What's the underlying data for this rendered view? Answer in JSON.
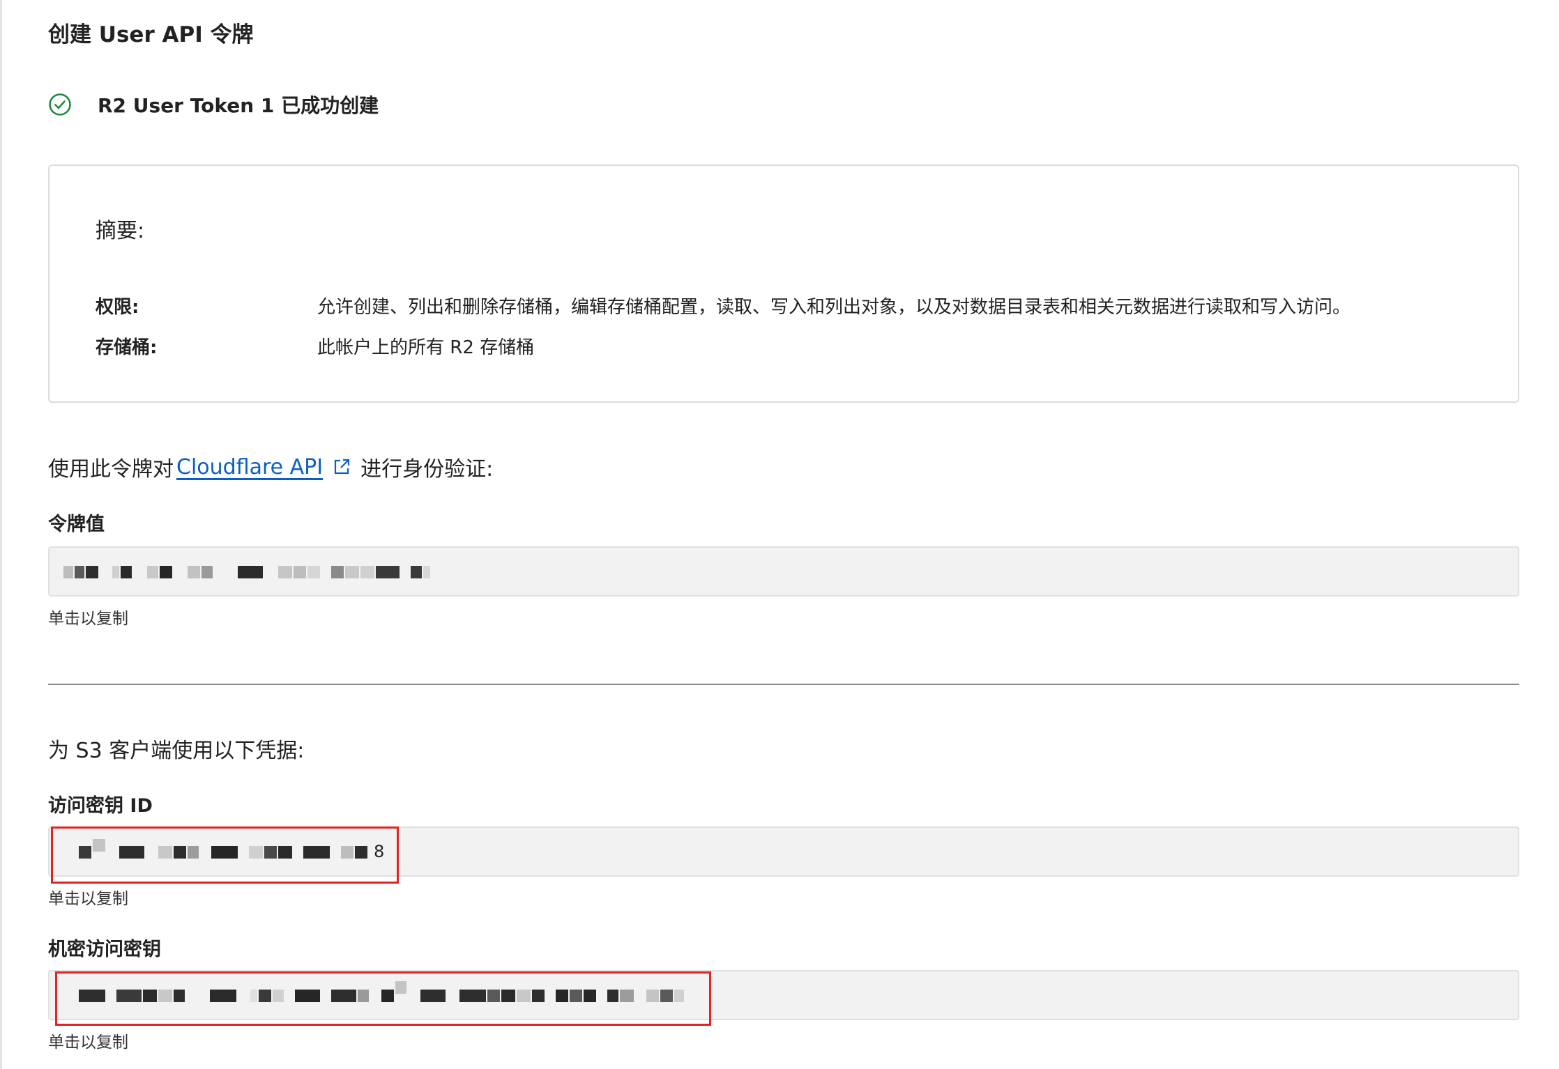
{
  "page": {
    "title": "创建 User API 令牌"
  },
  "success": {
    "icon": "check-circle-icon",
    "message": "R2 User Token 1 已成功创建",
    "color": "#1e8a3c"
  },
  "summary": {
    "heading": "摘要:",
    "rows": [
      {
        "label": "权限:",
        "value": "允许创建、列出和删除存储桶，编辑存储桶配置，读取、写入和列出对象，以及对数据目录表和相关元数据进行读取和写入访问。"
      },
      {
        "label": "存储桶:",
        "value": "此帐户上的所有 R2 存储桶"
      }
    ]
  },
  "auth": {
    "prefix": "使用此令牌对",
    "link_text": "Cloudflare API",
    "link_icon": "external-link-icon",
    "suffix": "进行身份验证:",
    "link_color": "#0a5fc7"
  },
  "token_field": {
    "label": "令牌值",
    "copy_hint": "单击以复制"
  },
  "s3": {
    "heading": "为 S3 客户端使用以下凭据:"
  },
  "access_key_field": {
    "label": "访问密钥 ID",
    "tail": "8",
    "copy_hint": "单击以复制"
  },
  "secret_key_field": {
    "label": "机密访问密钥",
    "copy_hint": "单击以复制"
  },
  "colors": {
    "highlight": "#e52222",
    "field_bg": "#f2f2f2"
  }
}
